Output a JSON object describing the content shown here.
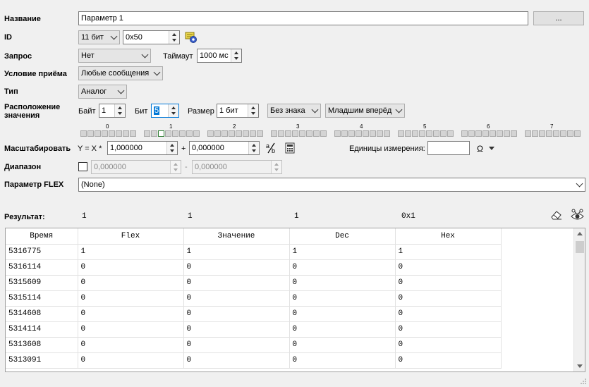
{
  "form": {
    "name": {
      "label": "Название",
      "value": "Параметр 1",
      "browse_label": "..."
    },
    "id": {
      "label": "ID",
      "bits_option": "11 бит",
      "value": "0x50"
    },
    "request": {
      "label": "Запрос",
      "value": "Нет",
      "timeout_label": "Таймаут",
      "timeout_value": "1000 мс"
    },
    "receive_condition": {
      "label": "Условие приёма",
      "value": "Любые сообщения"
    },
    "type": {
      "label": "Тип",
      "value": "Аналог"
    },
    "placement": {
      "label_line1": "Расположение",
      "label_line2": "значения",
      "byte_label": "Байт",
      "byte_value": "1",
      "bit_label": "Бит",
      "bit_value": "5",
      "size_label": "Размер",
      "size_value": "1 бит",
      "sign_value": "Без знака",
      "order_value": "Младшим вперёд"
    },
    "bytes": {
      "numbers": [
        "0",
        "1",
        "2",
        "3",
        "4",
        "5",
        "6",
        "7"
      ],
      "active_byte": 1,
      "active_bit": 5
    },
    "scale": {
      "label": "Масштабировать",
      "formula": "Y = X *",
      "multiplier": "1,000000",
      "plus": "+",
      "offset": "0,000000",
      "units_label": "Единицы измерения:",
      "units_value": "",
      "omega": "Ω"
    },
    "range": {
      "label": "Диапазон",
      "min": "0,000000",
      "dash": "-",
      "max": "0,000000",
      "checked": false
    },
    "flex": {
      "label": "Параметр FLEX",
      "value": "(None)"
    }
  },
  "result": {
    "label": "Результат:",
    "values": [
      "1",
      "1",
      "1",
      "0x1"
    ]
  },
  "table": {
    "columns": [
      "Время",
      "Flex",
      "Значение",
      "Dec",
      "Hex"
    ],
    "rows": [
      [
        "5316775",
        "1",
        "1",
        "1",
        "1"
      ],
      [
        "5316114",
        "0",
        "0",
        "0",
        "0"
      ],
      [
        "5315609",
        "0",
        "0",
        "0",
        "0"
      ],
      [
        "5315114",
        "0",
        "0",
        "0",
        "0"
      ],
      [
        "5314608",
        "0",
        "0",
        "0",
        "0"
      ],
      [
        "5314114",
        "0",
        "0",
        "0",
        "0"
      ],
      [
        "5313608",
        "0",
        "0",
        "0",
        "0"
      ],
      [
        "5313091",
        "0",
        "0",
        "0",
        "0"
      ]
    ]
  },
  "colors": {
    "accent": "#2e7d32",
    "selection": "#0078d7"
  }
}
